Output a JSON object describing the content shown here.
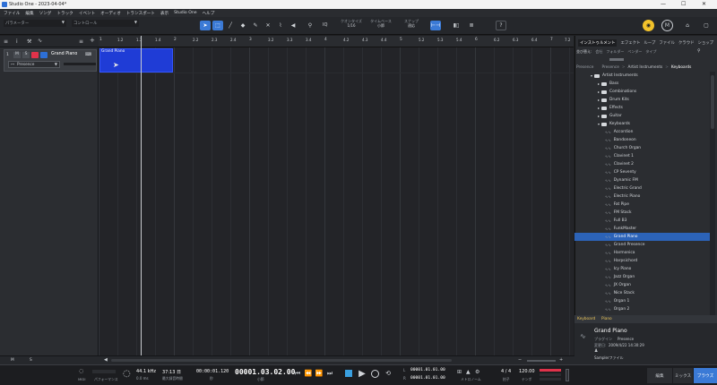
{
  "window": {
    "title": "Studio One - 2023-04-04*",
    "controls": [
      "—",
      "☐",
      "✕"
    ]
  },
  "menu": [
    "ファイル",
    "編集",
    "ソング",
    "トラック",
    "イベント",
    "オーディオ",
    "トランスポート",
    "表示",
    "Studio One",
    "ヘルプ"
  ],
  "toolbar": {
    "param_label": "パラメーター",
    "control_label": "コントロール",
    "iq": "IQ",
    "quantize_label": "クオンタイズ",
    "quantize_value": "1/16",
    "timebase_label": "タイムベース",
    "timebase_value": "小節",
    "snap_label": "スナップ",
    "snap_value": "適応",
    "help": "?"
  },
  "left_panel": {
    "track": {
      "number": "1",
      "m": "M",
      "s": "S",
      "name": "Grand Piano",
      "instrument": "Presence"
    },
    "bottom_m": "M",
    "bottom_s": "S"
  },
  "ruler": [
    "1",
    "1.2",
    "1.3",
    "1.4",
    "2",
    "2.2",
    "2.3",
    "2.4",
    "3",
    "3.2",
    "3.3",
    "3.4",
    "4",
    "4.2",
    "4.3",
    "4.4",
    "5",
    "5.2",
    "5.3",
    "5.4",
    "6",
    "6.2",
    "6.3",
    "6.4",
    "7",
    "7.2"
  ],
  "clip": {
    "name": "Grand Piano"
  },
  "browser": {
    "tabs": [
      "インストゥルメント",
      "エフェクト",
      "ループ",
      "ファイル",
      "クラウド",
      "ショップ"
    ],
    "filter_row": [
      "並び替え:",
      "会社",
      "フォルダー",
      "ベンダー",
      "タイプ"
    ],
    "breadcrumb": [
      "Presence",
      "Artist Instruments",
      "Keyboards"
    ],
    "breadcrumb_sep": ">",
    "breadcrumb_root": "Presence",
    "tree": [
      {
        "label": "Artist Instruments",
        "type": "folder",
        "indent": 0
      },
      {
        "label": "Bass",
        "type": "folder",
        "indent": 1
      },
      {
        "label": "Combinations",
        "type": "folder",
        "indent": 1
      },
      {
        "label": "Drum Kits",
        "type": "folder",
        "indent": 1
      },
      {
        "label": "Effects",
        "type": "folder",
        "indent": 1
      },
      {
        "label": "Guitar",
        "type": "folder",
        "indent": 1
      },
      {
        "label": "Keyboards",
        "type": "folder",
        "indent": 1
      },
      {
        "label": "Accordion",
        "type": "preset",
        "indent": 2
      },
      {
        "label": "Bandoneon",
        "type": "preset",
        "indent": 2
      },
      {
        "label": "Church Organ",
        "type": "preset",
        "indent": 2
      },
      {
        "label": "Clavinet 1",
        "type": "preset",
        "indent": 2
      },
      {
        "label": "Clavinet 2",
        "type": "preset",
        "indent": 2
      },
      {
        "label": "CP Seventy",
        "type": "preset",
        "indent": 2
      },
      {
        "label": "Dynamic FM",
        "type": "preset",
        "indent": 2
      },
      {
        "label": "Electric Grand",
        "type": "preset",
        "indent": 2
      },
      {
        "label": "Electric Piano",
        "type": "preset",
        "indent": 2
      },
      {
        "label": "Fat Pipe",
        "type": "preset",
        "indent": 2
      },
      {
        "label": "FM Stack",
        "type": "preset",
        "indent": 2
      },
      {
        "label": "Full B3",
        "type": "preset",
        "indent": 2
      },
      {
        "label": "FunkMaster",
        "type": "preset",
        "indent": 2
      },
      {
        "label": "Grand Piano",
        "type": "preset",
        "indent": 2,
        "selected": true
      },
      {
        "label": "Grand Presence",
        "type": "preset",
        "indent": 2
      },
      {
        "label": "Harmonica",
        "type": "preset",
        "indent": 2
      },
      {
        "label": "Harpsichord",
        "type": "preset",
        "indent": 2
      },
      {
        "label": "Icy Piano",
        "type": "preset",
        "indent": 2
      },
      {
        "label": "Jazz Organ",
        "type": "preset",
        "indent": 2
      },
      {
        "label": "JX Organ",
        "type": "preset",
        "indent": 2
      },
      {
        "label": "Nice Stack",
        "type": "preset",
        "indent": 2
      },
      {
        "label": "Organ 1",
        "type": "preset",
        "indent": 2
      },
      {
        "label": "Organ 2",
        "type": "preset",
        "indent": 2
      }
    ],
    "info": {
      "tags": [
        "Keyboard",
        "Piano"
      ],
      "name": "Grand Piano",
      "plugin_label": "プラグイン",
      "plugin_value": "Presence",
      "modified_label": "変更日:",
      "modified_value": "2009/4/22 14:30:29",
      "person_icon": "person-icon",
      "file_type": "Samplerファイル"
    }
  },
  "transport": {
    "midi_label": "MIDI",
    "perf_label": "パフォーマンス",
    "sample_rate": "44.1 kHz",
    "latency": "0.0 ms",
    "record_max": "37:13 日",
    "record_max_label": "最大録音時間",
    "time_secondary": "00:00:01.120",
    "time_secondary_label": "秒",
    "time_main": "00001.03.02.00",
    "time_main_label": "小節",
    "loop_l": "00001.01.01.00",
    "loop_r": "00001.01.01.00",
    "loop_l_label": "L",
    "loop_r_label": "R",
    "metronome_label": "メトロノーム",
    "timesig": "4 / 4",
    "timesig_label": "拍子",
    "tempo": "120.00",
    "tempo_label": "テンポ",
    "tabs": [
      "編集",
      "ミックス",
      "ブラウズ"
    ]
  }
}
